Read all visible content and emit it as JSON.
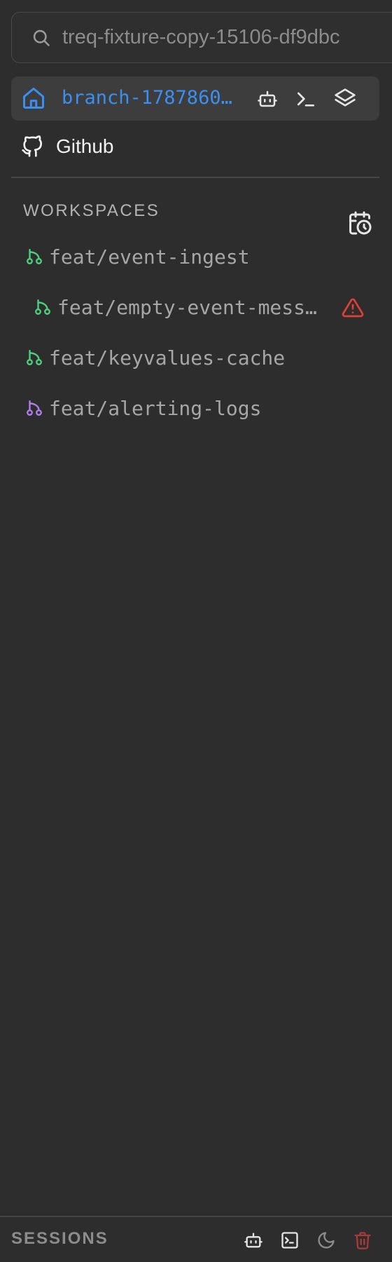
{
  "search": {
    "value": "treq-fixture-copy-15106-df9dbc",
    "icon": "search-icon"
  },
  "branch_bar": {
    "label": "branch-1787860…",
    "label_color": "#3b8ff0",
    "icons": [
      "home-icon",
      "robot-icon",
      "terminal-icon",
      "layers-icon"
    ]
  },
  "github": {
    "label": "Github",
    "icon": "github-icon"
  },
  "workspaces": {
    "title": "WORKSPACES",
    "schedule_icon": "calendar-clock-icon",
    "items": [
      {
        "label": "feat/event-ingest",
        "color": "#4cd07d",
        "indent": false,
        "warning": false
      },
      {
        "label": "feat/empty-event-mess…",
        "color": "#4cd07d",
        "indent": true,
        "warning": true
      },
      {
        "label": "feat/keyvalues-cache",
        "color": "#4cd07d",
        "indent": false,
        "warning": false
      },
      {
        "label": "feat/alerting-logs",
        "color": "#b07ee8",
        "indent": false,
        "warning": false
      }
    ],
    "warning_color": "#e0403a"
  },
  "sessions": {
    "title": "SESSIONS",
    "icons": [
      "robot-icon",
      "terminal-icon",
      "moon-icon",
      "trash-icon"
    ],
    "trash_color": "#a83a3a"
  }
}
